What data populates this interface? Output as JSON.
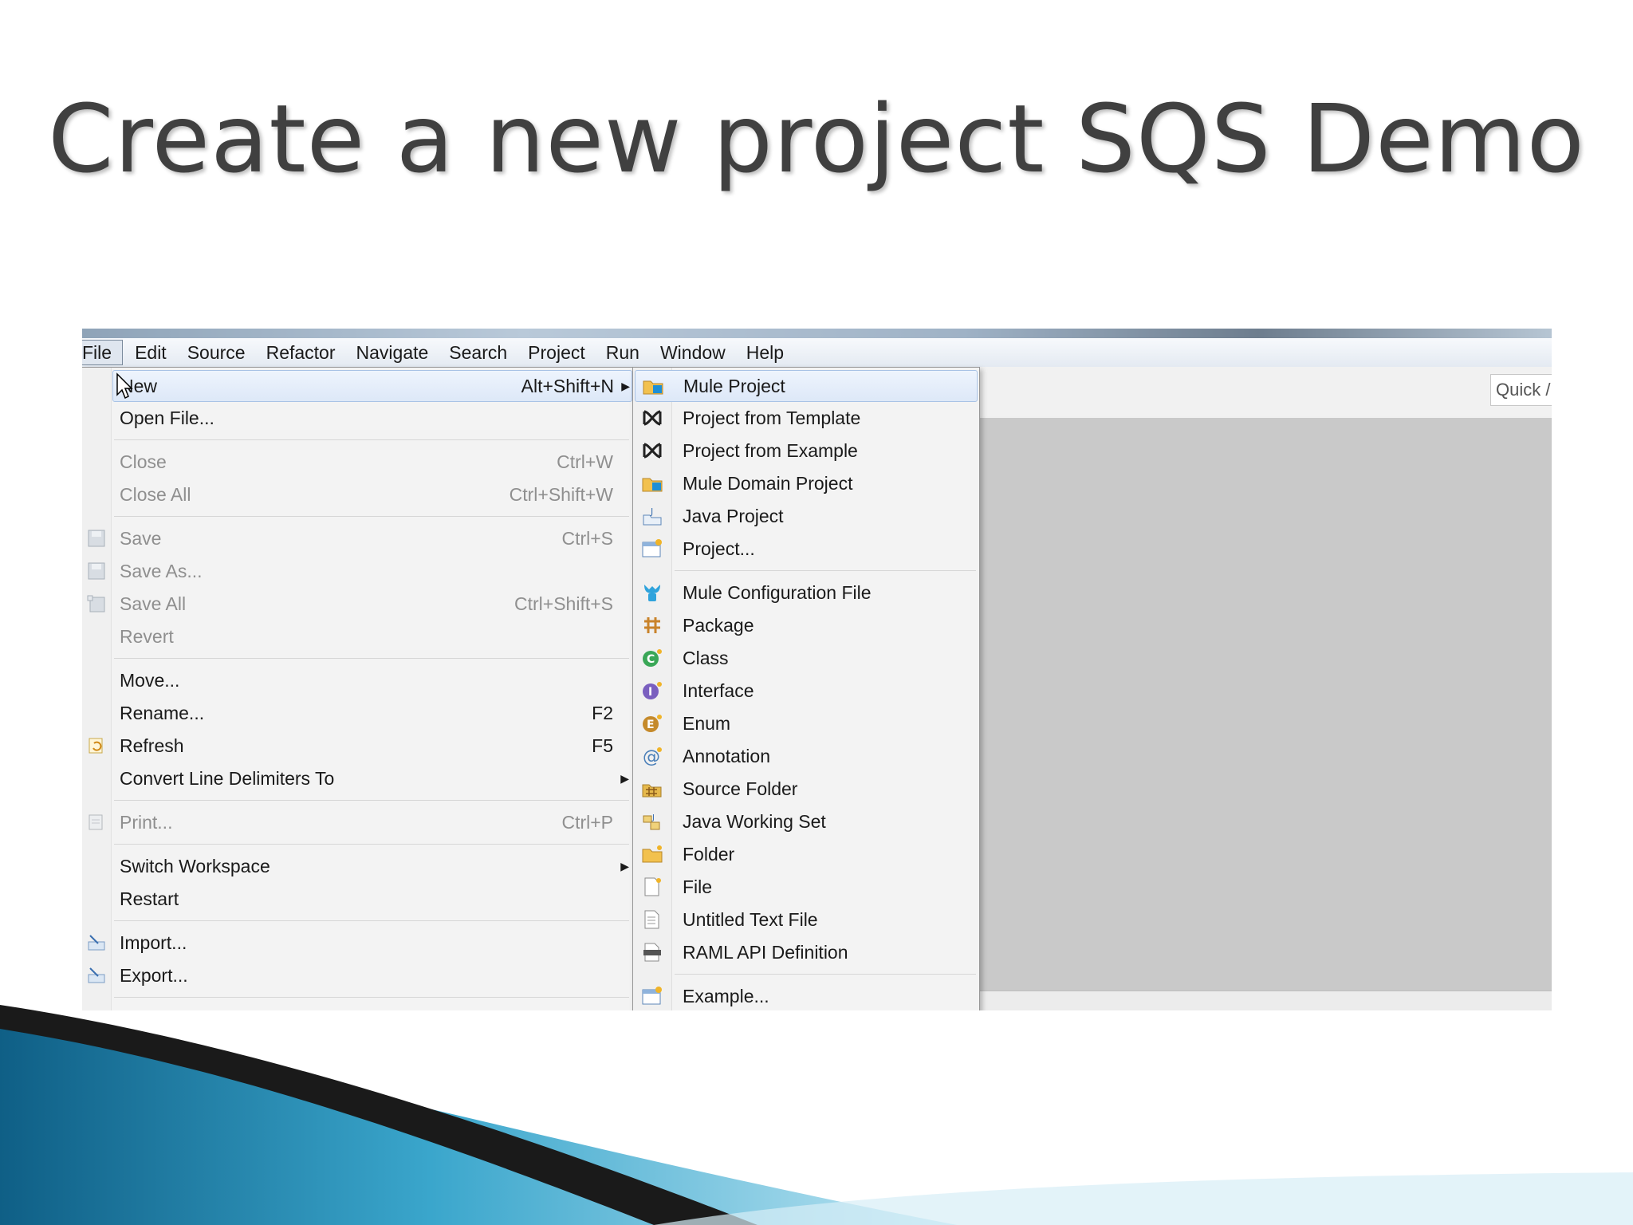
{
  "slide": {
    "title": "Create a new project SQS Demo"
  },
  "menubar": [
    {
      "label": "File",
      "active": true
    },
    {
      "label": "Edit"
    },
    {
      "label": "Source"
    },
    {
      "label": "Refactor"
    },
    {
      "label": "Navigate"
    },
    {
      "label": "Search"
    },
    {
      "label": "Project"
    },
    {
      "label": "Run"
    },
    {
      "label": "Window"
    },
    {
      "label": "Help"
    }
  ],
  "quick_access": {
    "placeholder": "Quick /"
  },
  "file_menu": [
    {
      "label": "New",
      "shortcut": "Alt+Shift+N",
      "submenu": true,
      "highlighted": true
    },
    {
      "label": "Open File..."
    },
    {
      "label": "Close",
      "shortcut": "Ctrl+W",
      "disabled": true
    },
    {
      "label": "Close All",
      "shortcut": "Ctrl+Shift+W",
      "disabled": true
    },
    {
      "label": "Save",
      "shortcut": "Ctrl+S",
      "disabled": true,
      "icon": "save-icon"
    },
    {
      "label": "Save As...",
      "disabled": true,
      "icon": "save-as-icon"
    },
    {
      "label": "Save All",
      "shortcut": "Ctrl+Shift+S",
      "disabled": true,
      "icon": "save-all-icon"
    },
    {
      "label": "Revert",
      "disabled": true
    },
    {
      "label": "Move..."
    },
    {
      "label": "Rename...",
      "shortcut": "F2"
    },
    {
      "label": "Refresh",
      "shortcut": "F5",
      "icon": "refresh-icon"
    },
    {
      "label": "Convert Line Delimiters To",
      "submenu": true
    },
    {
      "label": "Print...",
      "shortcut": "Ctrl+P",
      "disabled": true,
      "icon": "print-icon"
    },
    {
      "label": "Switch Workspace",
      "submenu": true
    },
    {
      "label": "Restart"
    },
    {
      "label": "Import...",
      "icon": "import-icon"
    },
    {
      "label": "Export...",
      "icon": "export-icon"
    }
  ],
  "new_submenu": [
    {
      "label": "Mule Project",
      "icon": "mule-project-icon",
      "highlighted": true
    },
    {
      "label": "Project from Template",
      "icon": "template-icon"
    },
    {
      "label": "Project from Example",
      "icon": "example-project-icon"
    },
    {
      "label": "Mule Domain Project",
      "icon": "mule-domain-icon"
    },
    {
      "label": "Java Project",
      "icon": "java-project-icon"
    },
    {
      "label": "Project...",
      "icon": "project-icon"
    },
    {
      "label": "Mule Configuration File",
      "icon": "mule-config-icon"
    },
    {
      "label": "Package",
      "icon": "package-icon"
    },
    {
      "label": "Class",
      "icon": "class-icon"
    },
    {
      "label": "Interface",
      "icon": "interface-icon"
    },
    {
      "label": "Enum",
      "icon": "enum-icon"
    },
    {
      "label": "Annotation",
      "icon": "annotation-icon"
    },
    {
      "label": "Source Folder",
      "icon": "source-folder-icon"
    },
    {
      "label": "Java Working Set",
      "icon": "working-set-icon"
    },
    {
      "label": "Folder",
      "icon": "folder-icon"
    },
    {
      "label": "File",
      "icon": "file-icon"
    },
    {
      "label": "Untitled Text File",
      "icon": "text-file-icon"
    },
    {
      "label": "RAML API Definition",
      "icon": "raml-icon"
    },
    {
      "label": "Example...",
      "icon": "example-icon"
    }
  ],
  "colors": {
    "title_text": "#404040",
    "menu_bg": "#f3f3f3",
    "highlight": "#dde8f8",
    "editor_bg": "#c9c9c9",
    "deco_blue": "#2a93b8"
  }
}
